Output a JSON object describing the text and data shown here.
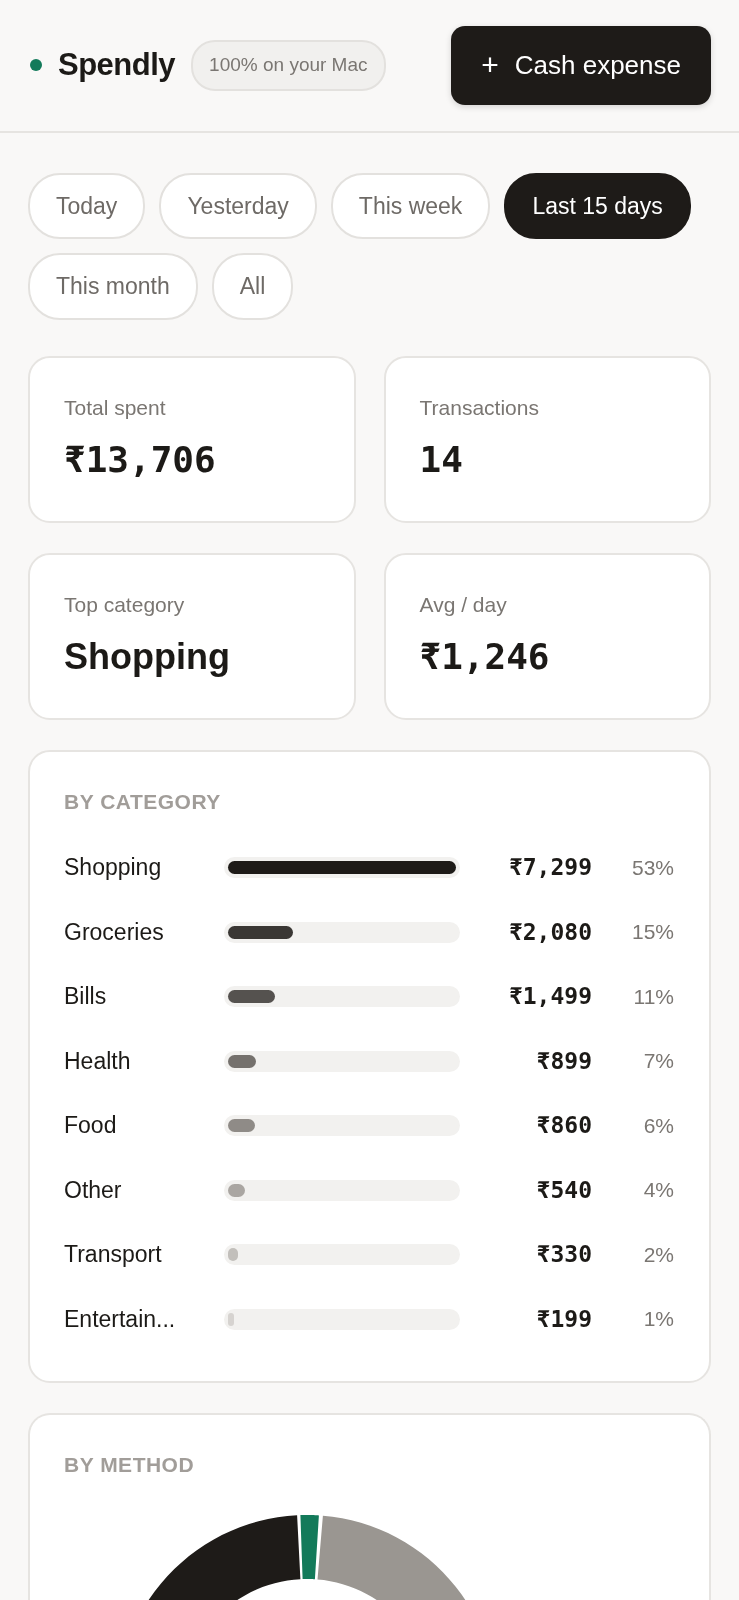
{
  "header": {
    "app_name": "Spendly",
    "badge": "100% on your Mac",
    "action_button": {
      "icon": "+",
      "label": "Cash expense"
    }
  },
  "periods": [
    {
      "label": "Today",
      "selected": false
    },
    {
      "label": "Yesterday",
      "selected": false
    },
    {
      "label": "This week",
      "selected": false
    },
    {
      "label": "Last 15 days",
      "selected": true
    },
    {
      "label": "This month",
      "selected": false
    },
    {
      "label": "All",
      "selected": false
    }
  ],
  "stats": [
    {
      "label": "Total spent",
      "value": "₹13,706",
      "kind": "money"
    },
    {
      "label": "Transactions",
      "value": "14",
      "kind": "money"
    },
    {
      "label": "Top category",
      "value": "Shopping",
      "kind": "text"
    },
    {
      "label": "Avg / day",
      "value": "₹1,246",
      "kind": "money"
    }
  ],
  "by_category": {
    "title": "BY CATEGORY",
    "rows": [
      {
        "name": "Shopping",
        "level": 1,
        "color": "#1e1b18",
        "amount": "₹7,299",
        "share": "53%"
      },
      {
        "name": "Groceries",
        "level": 0.285,
        "color": "#3a3734",
        "amount": "₹2,080",
        "share": "15%"
      },
      {
        "name": "Bills",
        "level": 0.205,
        "color": "#55524f",
        "amount": "₹1,499",
        "share": "11%"
      },
      {
        "name": "Health",
        "level": 0.123,
        "color": "#75716d",
        "amount": "₹899",
        "share": "7%"
      },
      {
        "name": "Food",
        "level": 0.118,
        "color": "#8f8b87",
        "amount": "₹860",
        "share": "6%"
      },
      {
        "name": "Other",
        "level": 0.074,
        "color": "#aaa6a2",
        "amount": "₹540",
        "share": "4%"
      },
      {
        "name": "Transport",
        "level": 0.045,
        "color": "#c2bfbb",
        "amount": "₹330",
        "share": "2%"
      },
      {
        "name": "Entertain...",
        "level": 0.027,
        "color": "#d6d3d0",
        "amount": "₹199",
        "share": "1%"
      }
    ]
  },
  "by_method": {
    "title": "BY METHOD"
  }
}
